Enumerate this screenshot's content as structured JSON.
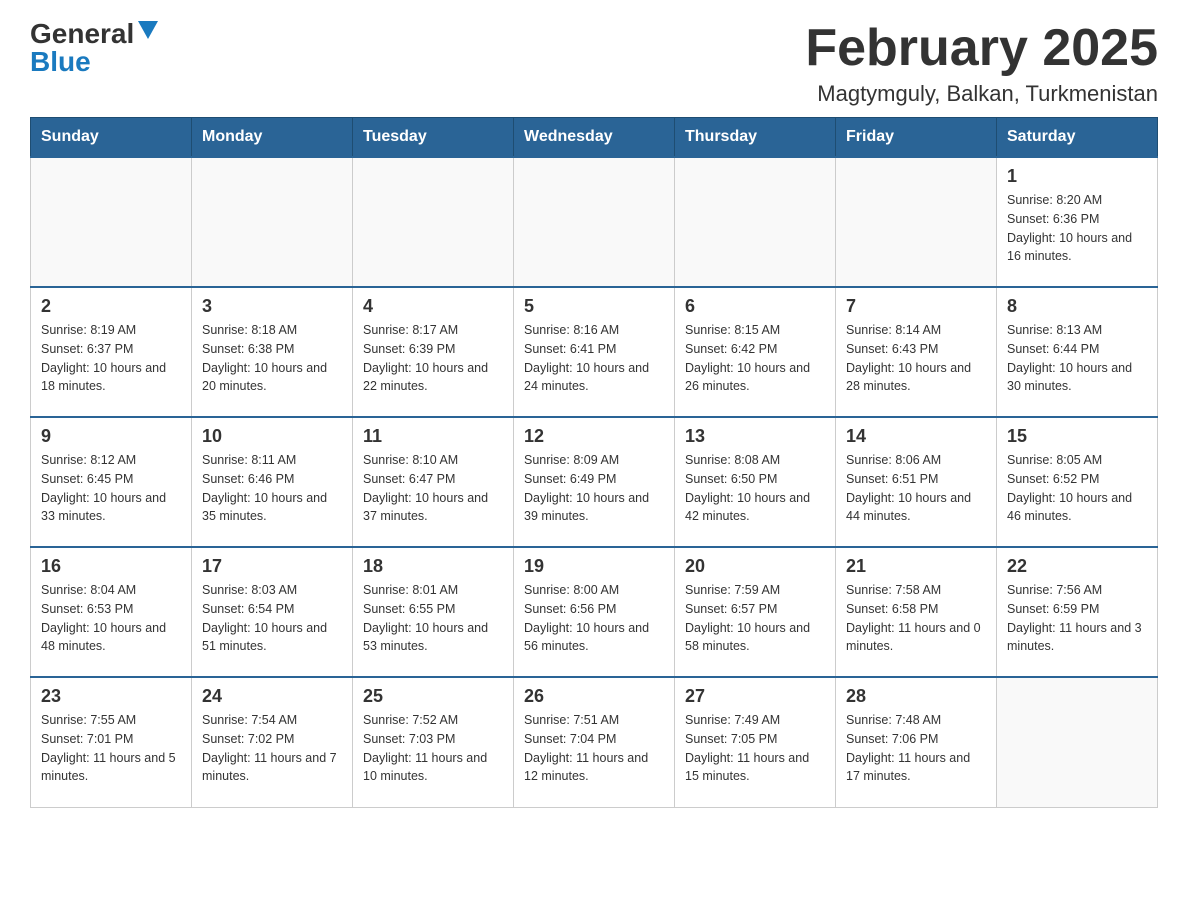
{
  "header": {
    "logo": {
      "general": "General",
      "blue": "Blue",
      "arrow": "▶"
    },
    "title": "February 2025",
    "subtitle": "Magtymguly, Balkan, Turkmenistan"
  },
  "days_of_week": [
    "Sunday",
    "Monday",
    "Tuesday",
    "Wednesday",
    "Thursday",
    "Friday",
    "Saturday"
  ],
  "weeks": [
    [
      {
        "day": "",
        "info": ""
      },
      {
        "day": "",
        "info": ""
      },
      {
        "day": "",
        "info": ""
      },
      {
        "day": "",
        "info": ""
      },
      {
        "day": "",
        "info": ""
      },
      {
        "day": "",
        "info": ""
      },
      {
        "day": "1",
        "info": "Sunrise: 8:20 AM\nSunset: 6:36 PM\nDaylight: 10 hours and 16 minutes."
      }
    ],
    [
      {
        "day": "2",
        "info": "Sunrise: 8:19 AM\nSunset: 6:37 PM\nDaylight: 10 hours and 18 minutes."
      },
      {
        "day": "3",
        "info": "Sunrise: 8:18 AM\nSunset: 6:38 PM\nDaylight: 10 hours and 20 minutes."
      },
      {
        "day": "4",
        "info": "Sunrise: 8:17 AM\nSunset: 6:39 PM\nDaylight: 10 hours and 22 minutes."
      },
      {
        "day": "5",
        "info": "Sunrise: 8:16 AM\nSunset: 6:41 PM\nDaylight: 10 hours and 24 minutes."
      },
      {
        "day": "6",
        "info": "Sunrise: 8:15 AM\nSunset: 6:42 PM\nDaylight: 10 hours and 26 minutes."
      },
      {
        "day": "7",
        "info": "Sunrise: 8:14 AM\nSunset: 6:43 PM\nDaylight: 10 hours and 28 minutes."
      },
      {
        "day": "8",
        "info": "Sunrise: 8:13 AM\nSunset: 6:44 PM\nDaylight: 10 hours and 30 minutes."
      }
    ],
    [
      {
        "day": "9",
        "info": "Sunrise: 8:12 AM\nSunset: 6:45 PM\nDaylight: 10 hours and 33 minutes."
      },
      {
        "day": "10",
        "info": "Sunrise: 8:11 AM\nSunset: 6:46 PM\nDaylight: 10 hours and 35 minutes."
      },
      {
        "day": "11",
        "info": "Sunrise: 8:10 AM\nSunset: 6:47 PM\nDaylight: 10 hours and 37 minutes."
      },
      {
        "day": "12",
        "info": "Sunrise: 8:09 AM\nSunset: 6:49 PM\nDaylight: 10 hours and 39 minutes."
      },
      {
        "day": "13",
        "info": "Sunrise: 8:08 AM\nSunset: 6:50 PM\nDaylight: 10 hours and 42 minutes."
      },
      {
        "day": "14",
        "info": "Sunrise: 8:06 AM\nSunset: 6:51 PM\nDaylight: 10 hours and 44 minutes."
      },
      {
        "day": "15",
        "info": "Sunrise: 8:05 AM\nSunset: 6:52 PM\nDaylight: 10 hours and 46 minutes."
      }
    ],
    [
      {
        "day": "16",
        "info": "Sunrise: 8:04 AM\nSunset: 6:53 PM\nDaylight: 10 hours and 48 minutes."
      },
      {
        "day": "17",
        "info": "Sunrise: 8:03 AM\nSunset: 6:54 PM\nDaylight: 10 hours and 51 minutes."
      },
      {
        "day": "18",
        "info": "Sunrise: 8:01 AM\nSunset: 6:55 PM\nDaylight: 10 hours and 53 minutes."
      },
      {
        "day": "19",
        "info": "Sunrise: 8:00 AM\nSunset: 6:56 PM\nDaylight: 10 hours and 56 minutes."
      },
      {
        "day": "20",
        "info": "Sunrise: 7:59 AM\nSunset: 6:57 PM\nDaylight: 10 hours and 58 minutes."
      },
      {
        "day": "21",
        "info": "Sunrise: 7:58 AM\nSunset: 6:58 PM\nDaylight: 11 hours and 0 minutes."
      },
      {
        "day": "22",
        "info": "Sunrise: 7:56 AM\nSunset: 6:59 PM\nDaylight: 11 hours and 3 minutes."
      }
    ],
    [
      {
        "day": "23",
        "info": "Sunrise: 7:55 AM\nSunset: 7:01 PM\nDaylight: 11 hours and 5 minutes."
      },
      {
        "day": "24",
        "info": "Sunrise: 7:54 AM\nSunset: 7:02 PM\nDaylight: 11 hours and 7 minutes."
      },
      {
        "day": "25",
        "info": "Sunrise: 7:52 AM\nSunset: 7:03 PM\nDaylight: 11 hours and 10 minutes."
      },
      {
        "day": "26",
        "info": "Sunrise: 7:51 AM\nSunset: 7:04 PM\nDaylight: 11 hours and 12 minutes."
      },
      {
        "day": "27",
        "info": "Sunrise: 7:49 AM\nSunset: 7:05 PM\nDaylight: 11 hours and 15 minutes."
      },
      {
        "day": "28",
        "info": "Sunrise: 7:48 AM\nSunset: 7:06 PM\nDaylight: 11 hours and 17 minutes."
      },
      {
        "day": "",
        "info": ""
      }
    ]
  ]
}
